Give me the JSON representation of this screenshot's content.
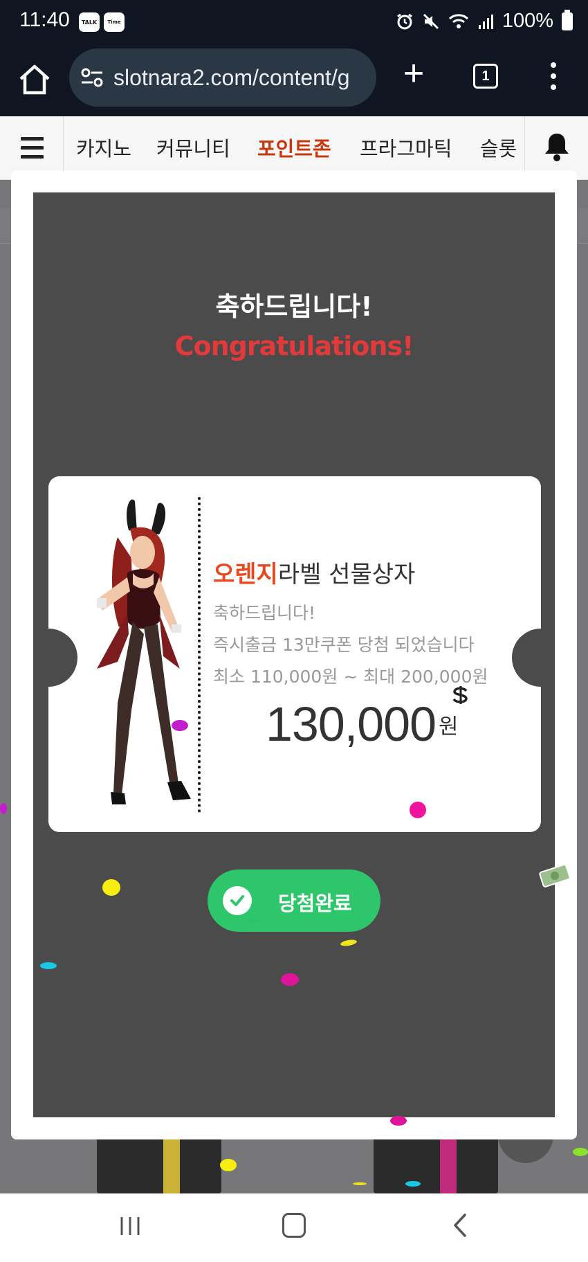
{
  "status_bar": {
    "time": "11:40",
    "app_icons": [
      "TALK",
      "Time"
    ],
    "battery": "100%",
    "indicators": [
      "alarm-icon",
      "mute-icon",
      "wifi-icon",
      "signal-icon",
      "battery-icon"
    ]
  },
  "browser": {
    "url": "slotnara2.com/content/g",
    "tab_count": "1",
    "new_tab_label": "+"
  },
  "site_nav": {
    "items": [
      {
        "label": "카지노",
        "active": false
      },
      {
        "label": "커뮤니티",
        "active": false
      },
      {
        "label": "포인트존",
        "active": true
      },
      {
        "label": "프라그마틱",
        "active": false
      },
      {
        "label": "슬롯",
        "active": false
      }
    ]
  },
  "modal": {
    "title_ko": "축하드립니다!",
    "title_en": "Congratulations!",
    "coupon": {
      "brand": "오렌지",
      "product": "라벨 선물상자",
      "line1": "축하드립니다!",
      "line2": "즉시출금 13만쿠폰 당첨 되었습니다",
      "line3": "최소 110,000원 ~ 최대 200,000원",
      "amount": "130,000",
      "unit": "원"
    },
    "done_button": "당첨완료"
  },
  "colors": {
    "accent_orange": "#e8481e",
    "nav_active": "#c8380f",
    "congrats_red": "#e2393a",
    "button_green": "#2ec66a",
    "modal_bg": "#4b4b4b"
  }
}
